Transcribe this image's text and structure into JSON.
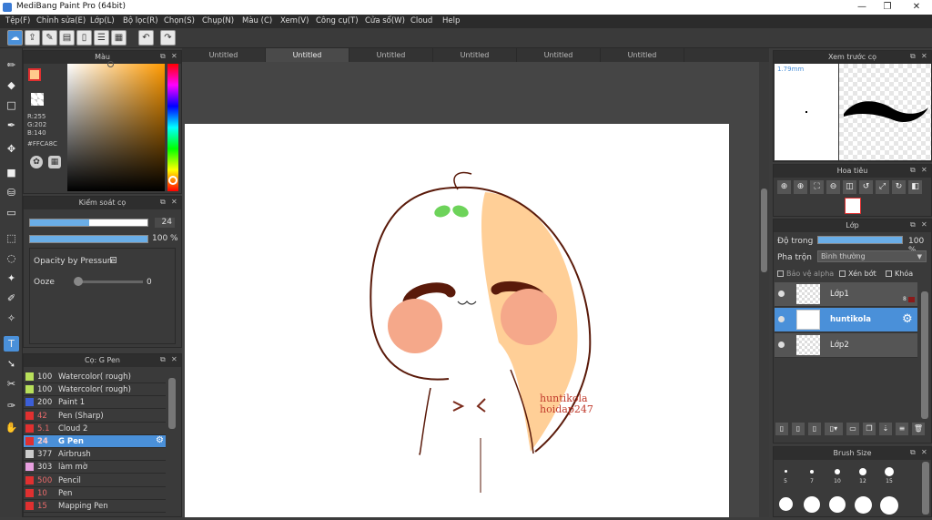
{
  "app": {
    "title": "MediBang Paint Pro (64bit)"
  },
  "window_controls": {
    "minimize": "—",
    "maximize": "❐",
    "close": "✕"
  },
  "menu": [
    "Tệp(F)",
    "Chỉnh sửa(E)",
    "Lớp(L)",
    "Bộ lọc(R)",
    "Chọn(S)",
    "Chụp(N)",
    "Màu (C)",
    "Xem(V)",
    "Công cụ(T)",
    "Cửa sổ(W)",
    "Cloud",
    "Help"
  ],
  "tabs": [
    "Untitled",
    "Untitled",
    "Untitled",
    "Untitled",
    "Untitled",
    "Untitled"
  ],
  "color_panel": {
    "title": "Màu",
    "r": "R:255",
    "g": "G:202",
    "b": "B:140",
    "hex": "#FFCA8C",
    "fg_color": "#FFCA8C"
  },
  "brush_control": {
    "title": "Kiểm soát cọ",
    "size_value": "24",
    "size_fill": 0.5,
    "opacity_value": "100 %",
    "opacity_fill": 1.0,
    "pressure_label": "Opacity by Pressure",
    "ooze_label": "Ooze",
    "ooze_value": "0"
  },
  "brush_list": {
    "title": "Cọ: G Pen",
    "items": [
      {
        "size": "100",
        "name": "Watercolor( rough)",
        "color": "#b8e05a"
      },
      {
        "size": "100",
        "name": "Watercolor( rough)",
        "color": "#b8e05a"
      },
      {
        "size": "200",
        "name": "Paint 1",
        "color": "#3c5fd8"
      },
      {
        "size": "42",
        "name": "Pen (Sharp)",
        "color": "#e03030"
      },
      {
        "size": "5.1",
        "name": "Cloud 2",
        "color": "#e03030"
      },
      {
        "size": "24",
        "name": "G Pen",
        "color": "#e03030",
        "selected": true
      },
      {
        "size": "377",
        "name": "Airbrush",
        "color": "#cccccc"
      },
      {
        "size": "303",
        "name": "làm mờ",
        "color": "#e8a0e0"
      },
      {
        "size": "500",
        "name": "Pencil",
        "color": "#e03030"
      },
      {
        "size": "10",
        "name": "Pen",
        "color": "#e03030"
      },
      {
        "size": "15",
        "name": "Mapping Pen",
        "color": "#e03030"
      }
    ]
  },
  "preview_panel": {
    "title": "Xem trước cọ",
    "size_label": "1.79mm"
  },
  "navigator": {
    "title": "Hoa tiêu"
  },
  "layer_panel": {
    "title": "Lớp",
    "opacity_label": "Độ trong",
    "opacity_value": "100 %",
    "blend_label": "Pha trộn",
    "blend_value": "Bình thường",
    "protect_alpha": "Bảo vệ alpha",
    "clipping": "Xén bớt",
    "lock": "Khóa",
    "layers": [
      {
        "name": "Lớp1",
        "selected": false
      },
      {
        "name": "huntikola",
        "selected": true
      },
      {
        "name": "Lớp2",
        "selected": false
      }
    ],
    "layer1_badge": "8"
  },
  "brush_size_panel": {
    "title": "Brush Size",
    "sizes": [
      "5",
      "7",
      "10",
      "12",
      "15"
    ]
  },
  "canvas": {
    "signature_line1": "huntikola",
    "signature_line2": "hoidap247"
  }
}
